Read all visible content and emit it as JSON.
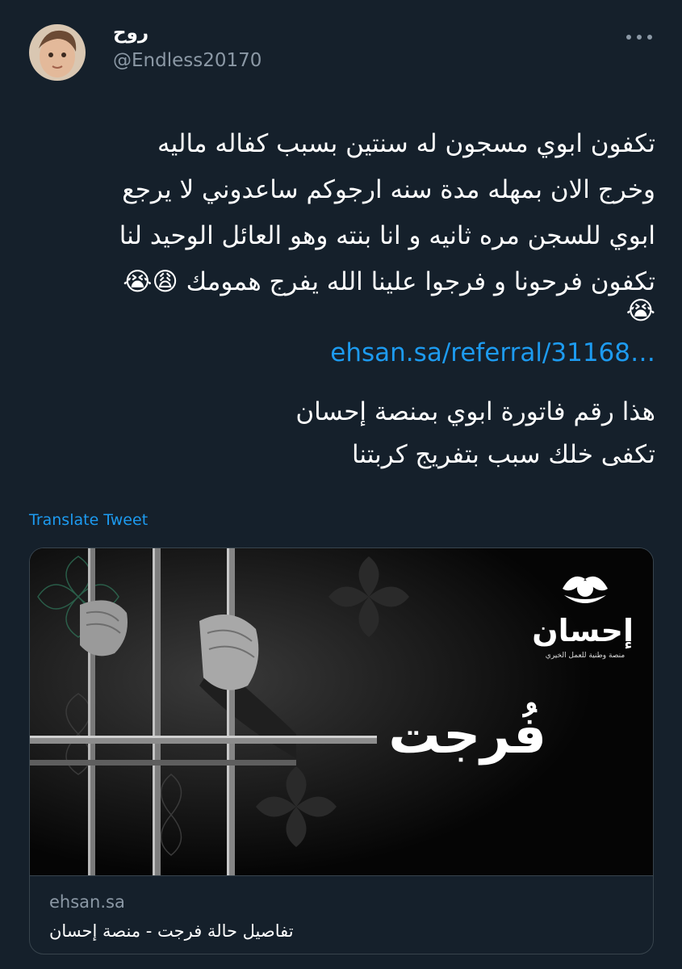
{
  "author": {
    "display_name": "روح",
    "handle": "@Endless20170"
  },
  "tweet": {
    "lines": [
      "تكفون ابوي مسجون له سنتين بسبب كفاله ماليه",
      "وخرج الان بمهله مدة سنه ارجوكم ساعدوني لا يرجع",
      "ابوي للسجن مره ثانيه و انا بنته وهو العائل الوحيد لنا",
      "تكفون فرحونا و فرجوا علينا الله يفرج همومك 😩😭",
      "😭"
    ],
    "link": "ehsan.sa/referral/31168…",
    "extra_lines": [
      "هذا رقم فاتورة ابوي بمنصة إحسان",
      "تكفى خلك سبب بتفريج كربتنا"
    ],
    "translate_label": "Translate Tweet"
  },
  "card": {
    "logo_text": "إحسان",
    "logo_tagline": "منصة وطنية للعمل الخيري",
    "headline": "فُرجت",
    "domain": "ehsan.sa",
    "title": "تفاصيل حالة فرجت - منصة إحسان"
  },
  "colors": {
    "background": "#15202b",
    "link": "#1d9bf0",
    "secondary_text": "#8b98a5",
    "border": "#38444d"
  }
}
